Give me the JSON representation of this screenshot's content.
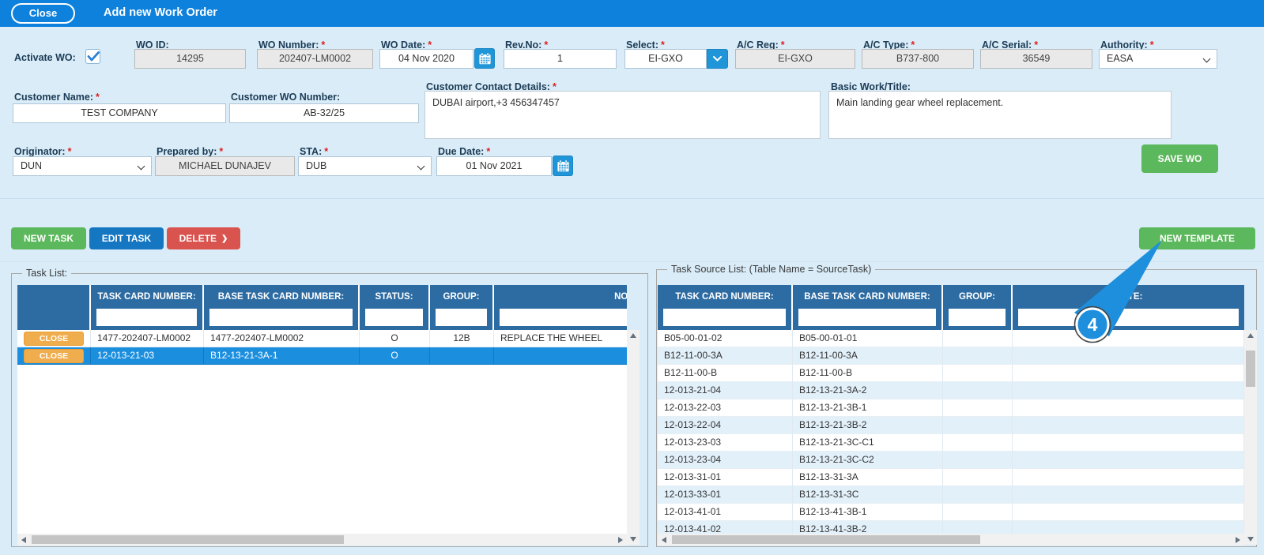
{
  "topbar": {
    "close_label": "Close",
    "title": "Add new Work Order"
  },
  "form": {
    "activate": {
      "label": "Activate WO:"
    },
    "wo_id": {
      "label": "WO ID:",
      "value": "14295"
    },
    "wo_number": {
      "label": "WO Number:",
      "required": "*",
      "value": "202407-LM0002"
    },
    "wo_date": {
      "label": "WO Date:",
      "required": "*",
      "value": "04 Nov 2020"
    },
    "rev_no": {
      "label": "Rev.No:",
      "required": "*",
      "value": "1"
    },
    "select": {
      "label": "Select:",
      "required": "*",
      "value": "EI-GXO"
    },
    "ac_reg": {
      "label": "A/C Reg:",
      "required": "*",
      "value": "EI-GXO"
    },
    "ac_type": {
      "label": "A/C Type:",
      "required": "*",
      "value": "B737-800"
    },
    "ac_serial": {
      "label": "A/C Serial:",
      "required": "*",
      "value": "36549"
    },
    "authority": {
      "label": "Authority:",
      "required": "*",
      "value": "EASA"
    },
    "customer_name": {
      "label": "Customer Name:",
      "required": "*",
      "value": "TEST COMPANY"
    },
    "customer_wo_number": {
      "label": "Customer WO Number:",
      "value": "AB-32/25"
    },
    "customer_contact": {
      "label": "Customer Contact Details:",
      "required": "*",
      "value": "DUBAI airport,+3 456347457"
    },
    "basic_work": {
      "label": "Basic Work/Title:",
      "value": "Main landing gear wheel replacement."
    },
    "originator": {
      "label": "Originator:",
      "required": "*",
      "value": "DUN"
    },
    "prepared_by": {
      "label": "Prepared by:",
      "required": "*",
      "value": "MICHAEL DUNAJEV"
    },
    "sta": {
      "label": "STA:",
      "required": "*",
      "value": "DUB"
    },
    "due_date": {
      "label": "Due Date:",
      "required": "*",
      "value": "01 Nov 2021"
    }
  },
  "toolbar": {
    "save_wo": "SAVE WO",
    "new_task": "NEW TASK",
    "edit_task": "EDIT TASK",
    "delete": "DELETE",
    "delete_chevron": "❯",
    "new_template": "NEW TEMPLATE"
  },
  "task_list": {
    "legend": "Task List:",
    "columns": [
      "TASK CARD NUMBER:",
      "BASE TASK CARD NUMBER:",
      "STATUS:",
      "GROUP:",
      "NOTE:"
    ],
    "rows": [
      {
        "close": "CLOSE",
        "task_card": "1477-202407-LM0002",
        "base_task_card": "1477-202407-LM0002",
        "status": "O",
        "group": "12B",
        "note": "REPLACE THE WHEEL",
        "selected": false
      },
      {
        "close": "CLOSE",
        "task_card": "12-013-21-03",
        "base_task_card": "B12-13-21-3A-1",
        "status": "O",
        "group": "",
        "note": "",
        "selected": true
      }
    ]
  },
  "source_list": {
    "legend": "Task Source List: (Table Name = SourceTask)",
    "columns": [
      "TASK CARD NUMBER:",
      "BASE TASK CARD NUMBER:",
      "GROUP:",
      "NOTE:"
    ],
    "rows": [
      {
        "task_card": "B05-00-01-02",
        "base_task_card": "B05-00-01-01",
        "group": "",
        "note": ""
      },
      {
        "task_card": "B12-11-00-3A",
        "base_task_card": "B12-11-00-3A",
        "group": "",
        "note": ""
      },
      {
        "task_card": "B12-11-00-B",
        "base_task_card": "B12-11-00-B",
        "group": "",
        "note": ""
      },
      {
        "task_card": "12-013-21-04",
        "base_task_card": "B12-13-21-3A-2",
        "group": "",
        "note": ""
      },
      {
        "task_card": "12-013-22-03",
        "base_task_card": "B12-13-21-3B-1",
        "group": "",
        "note": ""
      },
      {
        "task_card": "12-013-22-04",
        "base_task_card": "B12-13-21-3B-2",
        "group": "",
        "note": ""
      },
      {
        "task_card": "12-013-23-03",
        "base_task_card": "B12-13-21-3C-C1",
        "group": "",
        "note": ""
      },
      {
        "task_card": "12-013-23-04",
        "base_task_card": "B12-13-21-3C-C2",
        "group": "",
        "note": ""
      },
      {
        "task_card": "12-013-31-01",
        "base_task_card": "B12-13-31-3A",
        "group": "",
        "note": ""
      },
      {
        "task_card": "12-013-33-01",
        "base_task_card": "B12-13-31-3C",
        "group": "",
        "note": ""
      },
      {
        "task_card": "12-013-41-01",
        "base_task_card": "B12-13-41-3B-1",
        "group": "",
        "note": ""
      },
      {
        "task_card": "12-013-41-02",
        "base_task_card": "B12-13-41-3B-2",
        "group": "",
        "note": ""
      }
    ]
  },
  "annotation": {
    "step": "4"
  },
  "colors": {
    "topbar": "#0d81dc",
    "page_bg": "#d9ecf8",
    "table_header": "#2d6ca3",
    "selected_row": "#1b8ede",
    "green": "#5cb85c",
    "blue": "#1576c2",
    "red": "#d9534f",
    "orange": "#f0ad4e",
    "callout": "#1e8fdd"
  }
}
